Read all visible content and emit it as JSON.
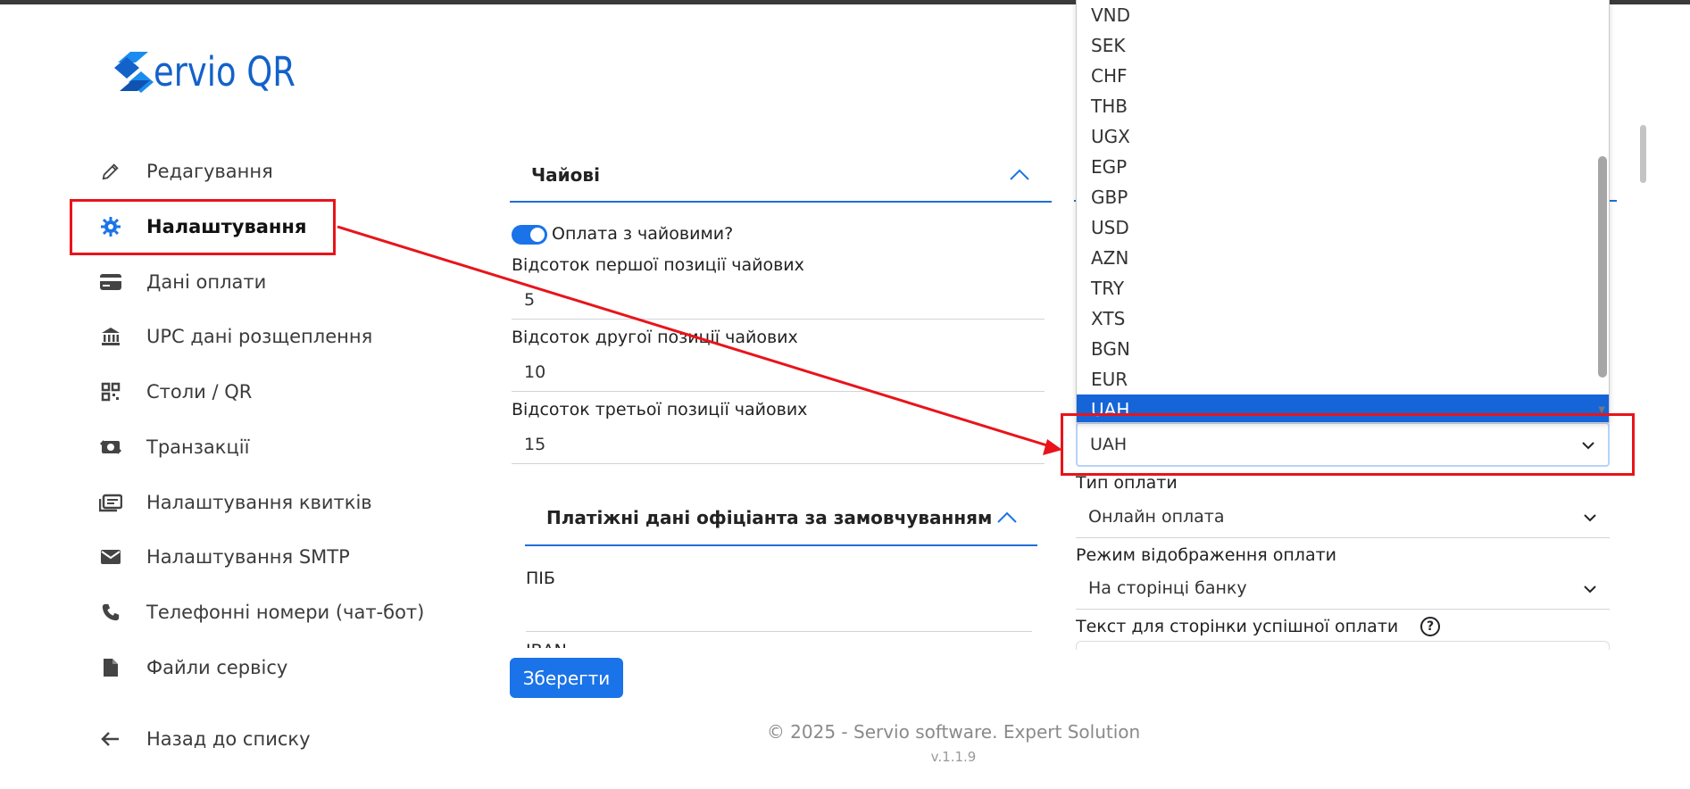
{
  "brand": {
    "logo_text": "ervio QR"
  },
  "sidebar": {
    "items": [
      {
        "label": "Редагування",
        "icon": "pencil-icon"
      },
      {
        "label": "Налаштування",
        "icon": "gear-icon"
      },
      {
        "label": "Дані оплати",
        "icon": "credit-card-icon"
      },
      {
        "label": "UPC дані розщеплення",
        "icon": "bank-icon"
      },
      {
        "label": "Столи / QR",
        "icon": "qr-code-icon"
      },
      {
        "label": "Транзакції",
        "icon": "cash-exchange-icon"
      },
      {
        "label": "Налаштування квитків",
        "icon": "ticket-icon"
      },
      {
        "label": "Налаштування SMTP",
        "icon": "envelope-icon"
      },
      {
        "label": "Телефонні номери (чат-бот)",
        "icon": "phone-icon"
      },
      {
        "label": "Файли сервісу",
        "icon": "file-icon"
      }
    ],
    "back_label": "Назад до списку"
  },
  "tips": {
    "header": "Чайові",
    "toggle_label": "Оплата з чайовими?",
    "first_label": "Відсоток першої позиції чайових",
    "first_value": "5",
    "second_label": "Відсоток другої позиції чайових",
    "second_value": "10",
    "third_label": "Відсоток третьої позиції чайових",
    "third_value": "15"
  },
  "waiter": {
    "header": "Платіжні дані офіціанта за замовчуванням",
    "name_label": "ПІБ",
    "iban_label_partial": "IBAN"
  },
  "save_label": "Зберегти",
  "footer": {
    "copyright": "© 2025 - Servio software. Expert Solution",
    "version": "v.1.1.9"
  },
  "right": {
    "currency_value": "UAH",
    "payment_type_label": "Тип оплати",
    "payment_type_value": "Онлайн оплата",
    "display_mode_label": "Режим відображення оплати",
    "display_mode_value": "На сторінці банку",
    "success_text_label": "Текст для сторінки успішної оплати"
  },
  "currency_dropdown": {
    "options": [
      "VND",
      "SEK",
      "CHF",
      "THB",
      "UGX",
      "EGP",
      "GBP",
      "USD",
      "AZN",
      "TRY",
      "XTS",
      "BGN",
      "EUR",
      "UAH"
    ],
    "selected": "UAH"
  },
  "colors": {
    "accent": "#1a73e8",
    "annotation": "#e8141a",
    "brand": "#1262c9"
  }
}
